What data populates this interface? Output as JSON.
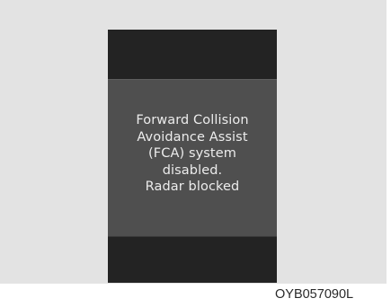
{
  "display": {
    "message_lines": [
      "Forward Collision",
      "Avoidance Assist",
      "(FCA) system",
      "disabled.",
      "Radar blocked"
    ]
  },
  "figure_code": "OYB057090L"
}
